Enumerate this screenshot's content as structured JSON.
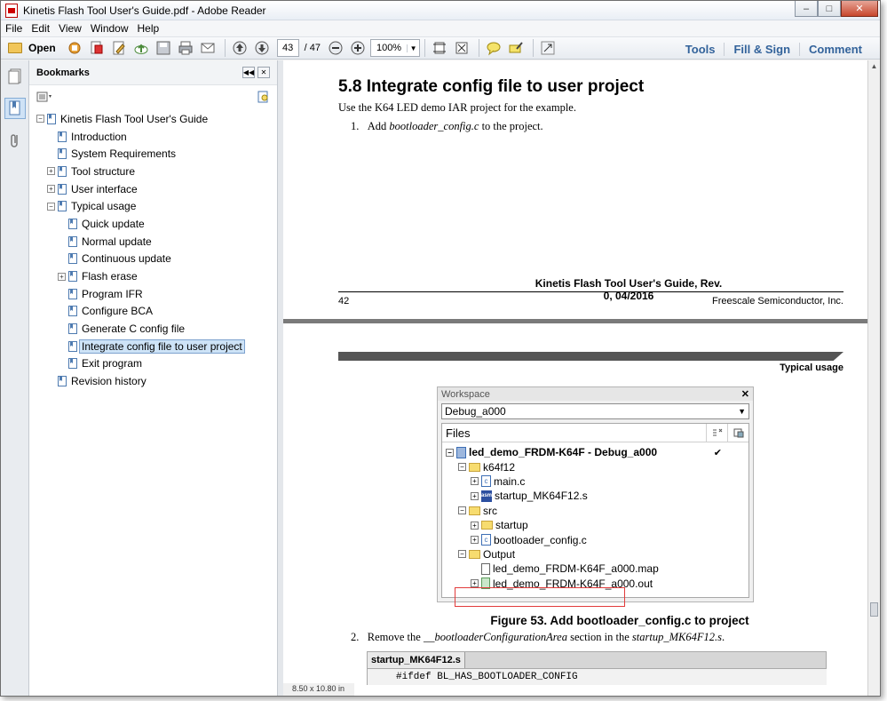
{
  "window": {
    "title": "Kinetis Flash Tool User's Guide.pdf - Adobe Reader",
    "controls": {
      "minimize": "–",
      "maximize": "□",
      "close": "✕"
    }
  },
  "menu": [
    "File",
    "Edit",
    "View",
    "Window",
    "Help"
  ],
  "toolbar": {
    "open_label": "Open",
    "page_current": "43",
    "page_total": "/ 47",
    "zoom": "100%",
    "right_links": [
      "Tools",
      "Fill & Sign",
      "Comment"
    ]
  },
  "bookmarks": {
    "title": "Bookmarks",
    "items": [
      {
        "label": "Kinetis Flash Tool User's Guide",
        "level": 0,
        "expand": "−"
      },
      {
        "label": "Introduction",
        "level": 1,
        "expand": ""
      },
      {
        "label": "System Requirements",
        "level": 1,
        "expand": ""
      },
      {
        "label": "Tool structure",
        "level": 1,
        "expand": "+"
      },
      {
        "label": "User interface",
        "level": 1,
        "expand": "+"
      },
      {
        "label": "Typical usage",
        "level": 1,
        "expand": "−"
      },
      {
        "label": "Quick update",
        "level": 2,
        "expand": ""
      },
      {
        "label": "Normal update",
        "level": 2,
        "expand": ""
      },
      {
        "label": "Continuous update",
        "level": 2,
        "expand": ""
      },
      {
        "label": "Flash erase",
        "level": 2,
        "expand": "+"
      },
      {
        "label": "Program IFR",
        "level": 2,
        "expand": ""
      },
      {
        "label": "Configure BCA",
        "level": 2,
        "expand": ""
      },
      {
        "label": "Generate C config file",
        "level": 2,
        "expand": ""
      },
      {
        "label": "Integrate config file to user project",
        "level": 2,
        "expand": "",
        "selected": true
      },
      {
        "label": "Exit program",
        "level": 2,
        "expand": ""
      },
      {
        "label": "Revision history",
        "level": 1,
        "expand": ""
      }
    ]
  },
  "page1": {
    "heading": "5.8   Integrate config file to user project",
    "intro": "Use the K64 LED demo IAR project for the example.",
    "step1_num": "1.",
    "step1_pre": "Add ",
    "step1_em": "bootloader_config.c",
    "step1_post": " to the project.",
    "footer_title": "Kinetis Flash Tool User's Guide, Rev. 0, 04/2016",
    "page_number": "42",
    "company": "Freescale Semiconductor, Inc."
  },
  "page2": {
    "section": "Typical usage",
    "workspace": {
      "title": "Workspace",
      "config": "Debug_a000",
      "files_header": "Files",
      "rows": [
        {
          "label": "led_demo_FRDM-K64F - Debug_a000",
          "depth": 0,
          "icon": "project",
          "expand": "−",
          "bold": true
        },
        {
          "label": "k64f12",
          "depth": 1,
          "icon": "folder",
          "expand": "−"
        },
        {
          "label": "main.c",
          "depth": 2,
          "icon": "cfile",
          "expand": "+"
        },
        {
          "label": "startup_MK64F12.s",
          "depth": 2,
          "icon": "sfile",
          "expand": "+"
        },
        {
          "label": "src",
          "depth": 1,
          "icon": "folder",
          "expand": "−"
        },
        {
          "label": "startup",
          "depth": 2,
          "icon": "folder",
          "expand": "+"
        },
        {
          "label": "bootloader_config.c",
          "depth": 2,
          "icon": "cfile",
          "expand": "+"
        },
        {
          "label": "Output",
          "depth": 1,
          "icon": "folder",
          "expand": "−"
        },
        {
          "label": "led_demo_FRDM-K64F_a000.map",
          "depth": 2,
          "icon": "mapfile",
          "expand": ""
        },
        {
          "label": "led_demo_FRDM-K64F_a000.out",
          "depth": 2,
          "icon": "outfile",
          "expand": "+"
        }
      ]
    },
    "figure_caption": "Figure 53. Add bootloader_config.c to project",
    "step2_num": "2.",
    "step2_pre": "Remove the ",
    "step2_em1": "__bootloaderConfigurationArea",
    "step2_mid": " section in the ",
    "step2_em2": "startup_MK64F12.s",
    "step2_post": ".",
    "code_tab": "startup_MK64F12.s",
    "code_line": "#ifdef BL_HAS_BOOTLOADER_CONFIG"
  },
  "status": {
    "page_size": "8.50 x 10.80 in"
  }
}
